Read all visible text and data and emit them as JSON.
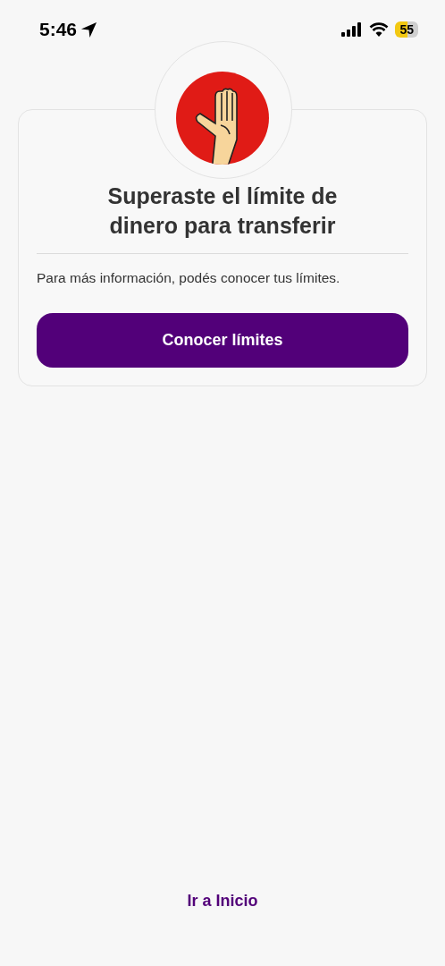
{
  "status_bar": {
    "time": "5:46",
    "battery": "55"
  },
  "card": {
    "title": "Superaste el límite de dinero para transferir",
    "message": "Para más información, podés conocer tus límites.",
    "button": "Conocer límites"
  },
  "footer_link": "Ir a Inicio"
}
